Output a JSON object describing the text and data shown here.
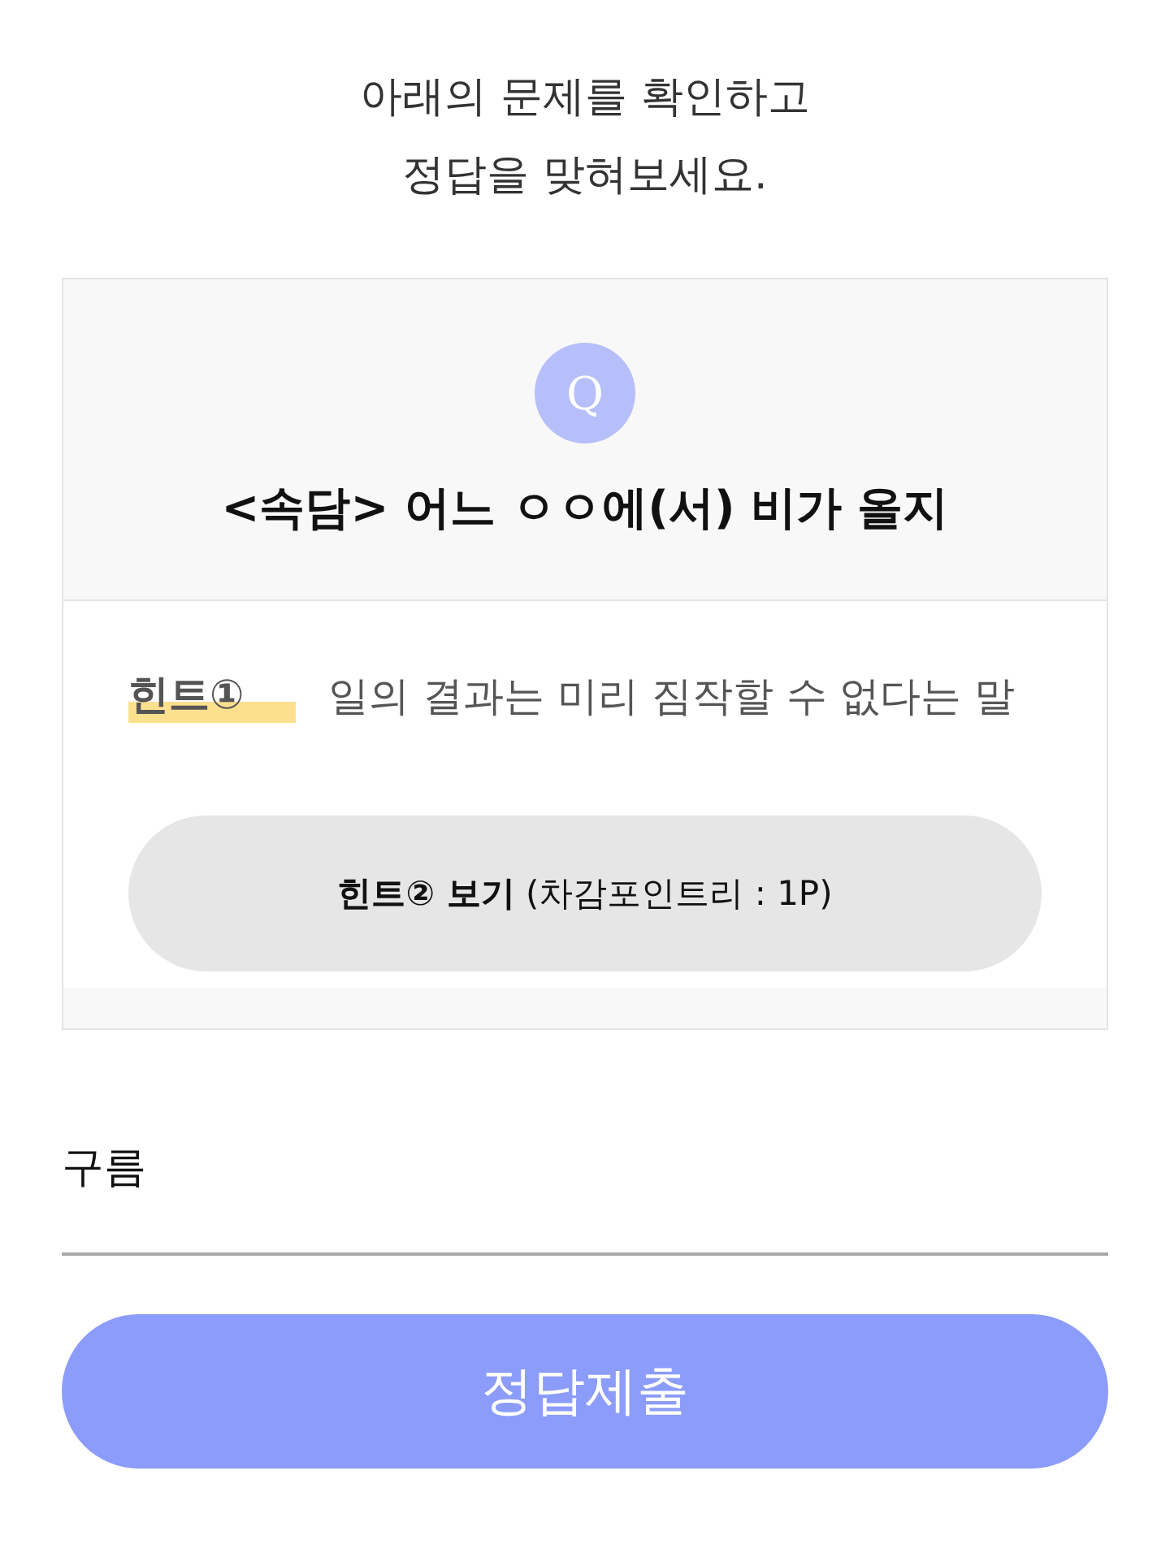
{
  "instructions": {
    "lines": [
      "아래의 문제를 확인하고",
      "정답을 맞혀보세요."
    ]
  },
  "question": {
    "badge": "Q",
    "title": "<속담> 어느 ㅇㅇ에(서) 비가 올지"
  },
  "hints": [
    {
      "label": "힌트①",
      "text": "일의 결과는 미리 짐작할 수 없다는 말"
    }
  ],
  "hint_button": {
    "label": "**힌트② 보기** (차감포인트리 : 1P)"
  },
  "answer": {
    "value": "구름"
  },
  "submit": {
    "label": "정답제출"
  }
}
